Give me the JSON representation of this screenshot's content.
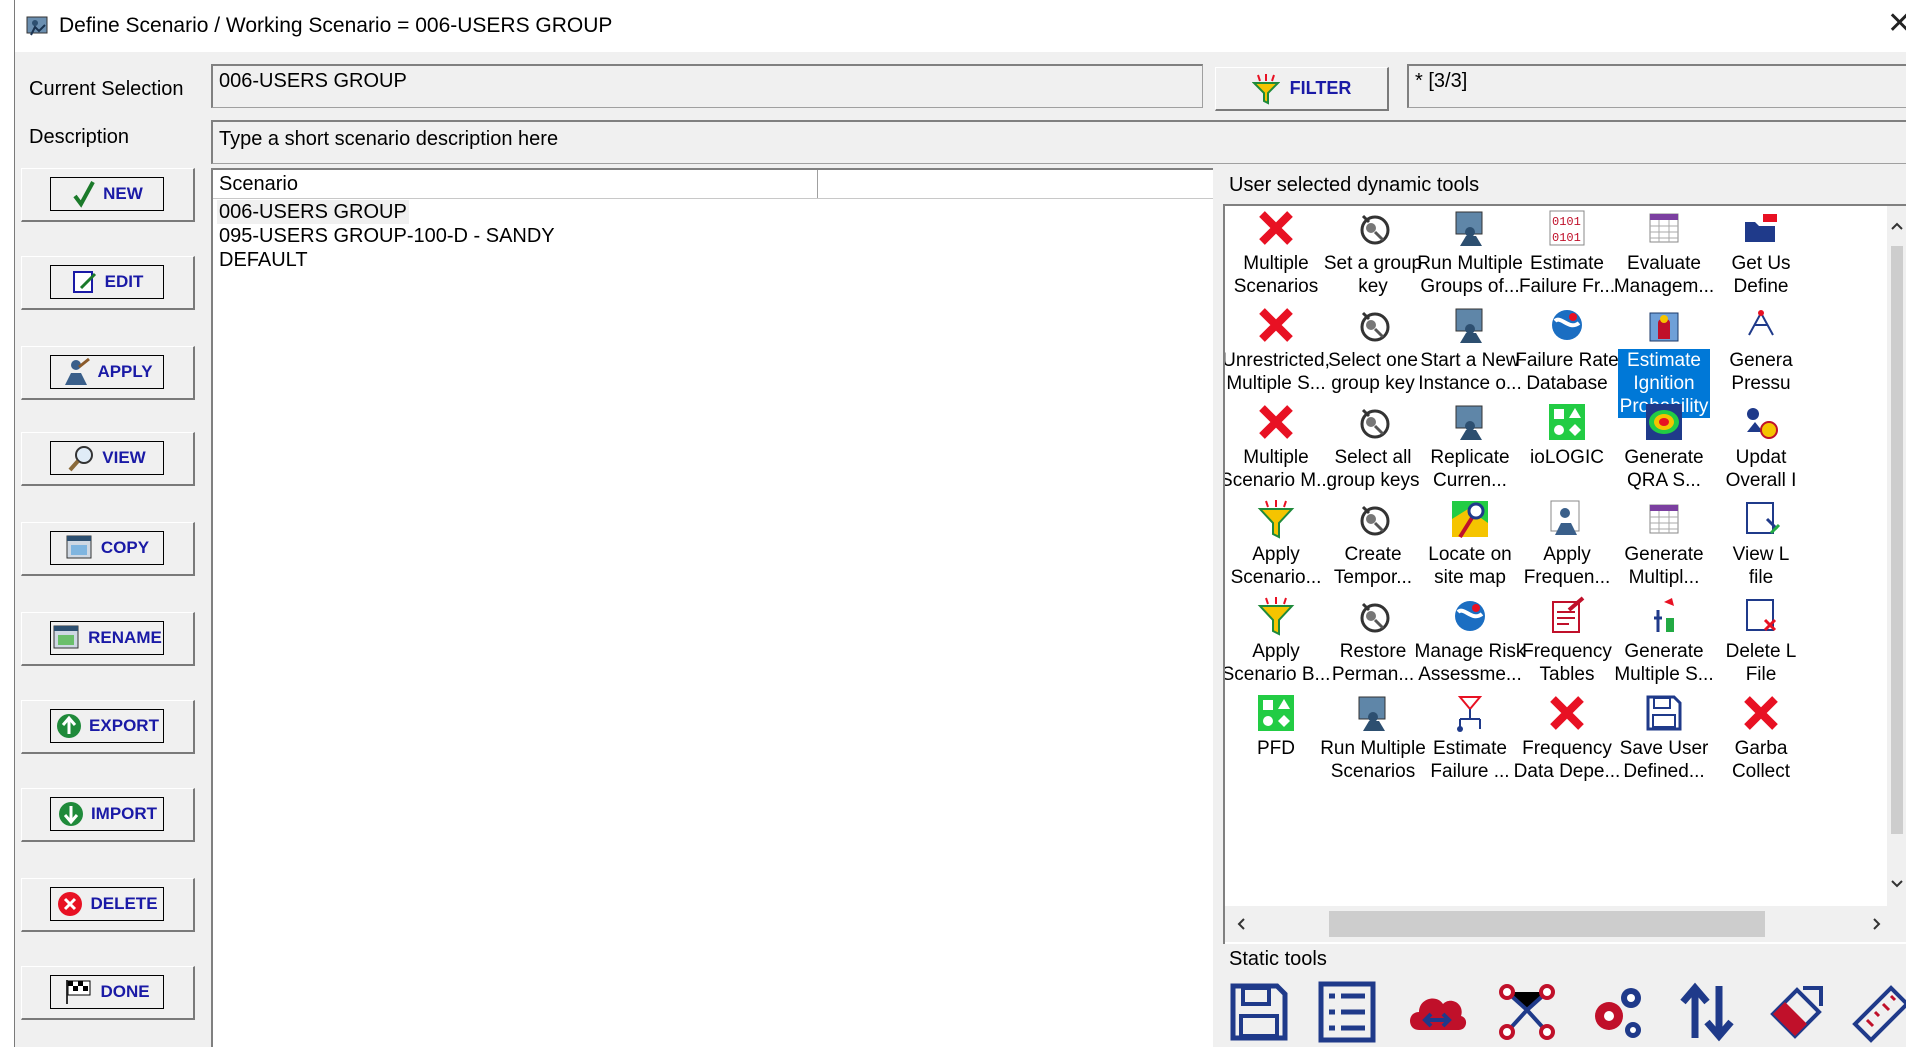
{
  "window": {
    "title": "Define Scenario / Working Scenario = 006-USERS GROUP",
    "close_glyph": "✕"
  },
  "current_selection": {
    "label": "Current Selection",
    "value": "006-USERS GROUP"
  },
  "filter": {
    "label": "FILTER",
    "count": "* [3/3]"
  },
  "description": {
    "label": "Description",
    "value": "Type a short scenario description here"
  },
  "side_buttons": [
    {
      "label": "NEW",
      "icon": "check-icon"
    },
    {
      "label": "EDIT",
      "icon": "edit-icon"
    },
    {
      "label": "APPLY",
      "icon": "apply-icon"
    },
    {
      "label": "VIEW",
      "icon": "magnifier-icon"
    },
    {
      "label": "COPY",
      "icon": "copy-icon"
    },
    {
      "label": "RENAME",
      "icon": "rename-icon"
    },
    {
      "label": "EXPORT",
      "icon": "export-icon"
    },
    {
      "label": "IMPORT",
      "icon": "import-icon"
    },
    {
      "label": "DELETE",
      "icon": "delete-icon"
    },
    {
      "label": "DONE",
      "icon": "checkered-flag-icon"
    }
  ],
  "scenario_list": {
    "header": "Scenario",
    "rows": [
      "006-USERS GROUP",
      "095-USERS GROUP-100-D - SANDY",
      "DEFAULT"
    ],
    "selected_index": 0
  },
  "dynamic_tools": {
    "label": "User selected dynamic tools",
    "items": [
      {
        "line1": "Multiple",
        "line2": "Scenarios",
        "icon": "red-x-icon"
      },
      {
        "line1": "Set a group",
        "line2": "key",
        "icon": "key-group-icon"
      },
      {
        "line1": "Run Multiple",
        "line2": "Groups of...",
        "icon": "run-person-icon"
      },
      {
        "line1": "Estimate",
        "line2": "Failure Fr...",
        "icon": "binary-icon"
      },
      {
        "line1": "Evaluate",
        "line2": "Managem...",
        "icon": "table-icon"
      },
      {
        "line1": "Get Us",
        "line2": "Define",
        "icon": "open-folder-icon"
      },
      {
        "line1": "Unrestricted,",
        "line2": "Multiple S...",
        "icon": "red-x-icon"
      },
      {
        "line1": "Select one",
        "line2": "group key",
        "icon": "key-group-icon"
      },
      {
        "line1": "Start a New",
        "line2": "Instance o...",
        "icon": "run-person-icon"
      },
      {
        "line1": "Failure Rate",
        "line2": "Database",
        "icon": "globe-icon"
      },
      {
        "line1": "Estimate",
        "line2": "Ignition",
        "line3": "Probability",
        "icon": "ignition-icon",
        "selected": true
      },
      {
        "line1": "Genera",
        "line2": "Pressu",
        "icon": "pressure-icon"
      },
      {
        "line1": "Multiple",
        "line2": "Scenario M...",
        "icon": "red-x-icon"
      },
      {
        "line1": "Select all",
        "line2": "group keys",
        "icon": "key-group-icon"
      },
      {
        "line1": "Replicate",
        "line2": "Curren...",
        "icon": "run-person-icon"
      },
      {
        "line1": "ioLOGIC",
        "line2": "",
        "icon": "logic-blocks-icon"
      },
      {
        "line1": "Generate",
        "line2": "QRA S...",
        "icon": "contour-icon"
      },
      {
        "line1": "Updat",
        "line2": "Overall I",
        "icon": "update-icon"
      },
      {
        "line1": "Apply",
        "line2": "Scenario...",
        "icon": "funnel-icon"
      },
      {
        "line1": "Create",
        "line2": "Tempor...",
        "icon": "key-group-icon"
      },
      {
        "line1": "Locate on",
        "line2": "site map",
        "icon": "map-icon"
      },
      {
        "line1": "Apply",
        "line2": "Frequen...",
        "icon": "apply-person-icon"
      },
      {
        "line1": "Generate",
        "line2": "Multipl...",
        "icon": "table-icon"
      },
      {
        "line1": "View L",
        "line2": "file",
        "icon": "view-log-icon"
      },
      {
        "line1": "Apply",
        "line2": "Scenario B...",
        "icon": "funnel-icon"
      },
      {
        "line1": "Restore",
        "line2": "Perman...",
        "icon": "key-group-icon"
      },
      {
        "line1": "Manage Risk",
        "line2": "Assessme...",
        "icon": "globe-icon"
      },
      {
        "line1": "Frequency",
        "line2": "Tables",
        "icon": "doc-edit-icon"
      },
      {
        "line1": "Generate",
        "line2": "Multiple S...",
        "icon": "probe-icon"
      },
      {
        "line1": "Delete L",
        "line2": "File",
        "icon": "delete-log-icon"
      },
      {
        "line1": "PFD",
        "line2": "",
        "icon": "logic-blocks-icon"
      },
      {
        "line1": "Run Multiple",
        "line2": "Scenarios",
        "icon": "run-person-icon"
      },
      {
        "line1": "Estimate",
        "line2": "Failure ...",
        "icon": "failure-tree-icon"
      },
      {
        "line1": "Frequency",
        "line2": "Data Depe...",
        "icon": "red-x-icon"
      },
      {
        "line1": "Save User",
        "line2": "Defined...",
        "icon": "save-icon"
      },
      {
        "line1": "Garba",
        "line2": "Collect",
        "icon": "red-x-icon"
      }
    ]
  },
  "static_tools": {
    "label": "Static tools",
    "items": [
      "save-icon",
      "list-icon",
      "cloud-transfer-icon",
      "network-icon",
      "gears-icon",
      "sort-arrows-icon",
      "eraser-icon",
      "ruler-icon"
    ]
  },
  "colors": {
    "accent": "#1a1aa6",
    "selection": "#0078d7",
    "red": "#e81123",
    "panel": "#f0f0f0"
  }
}
